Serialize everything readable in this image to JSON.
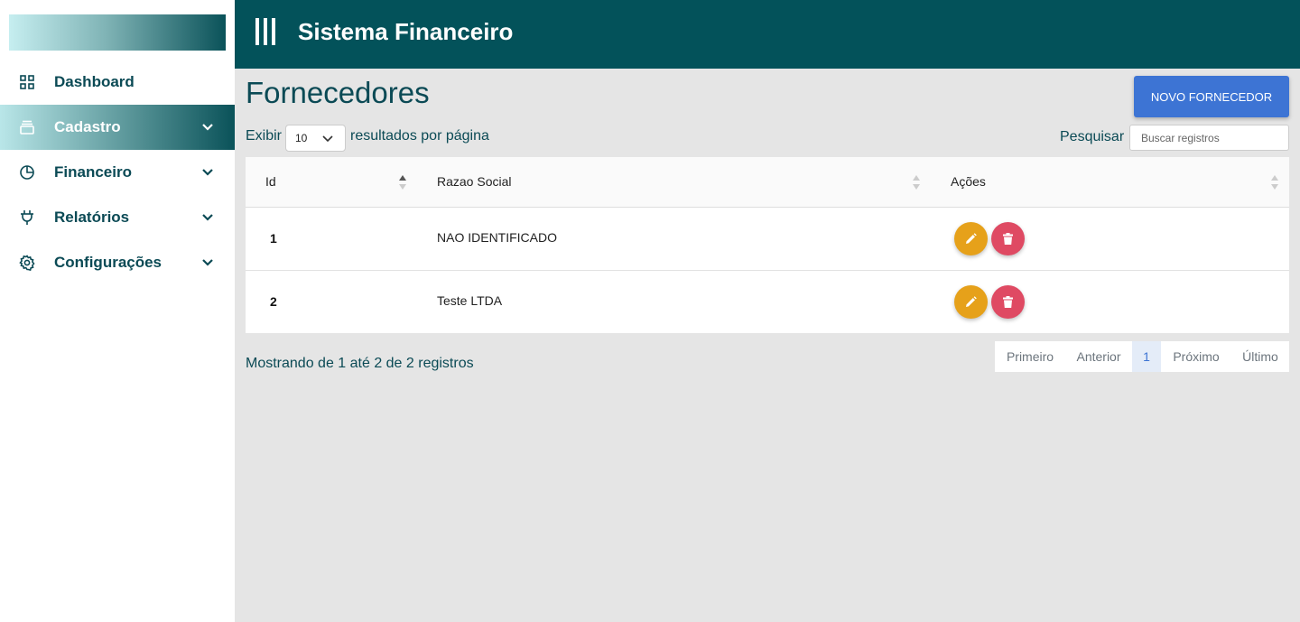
{
  "header": {
    "title": "Sistema Financeiro"
  },
  "sidebar": {
    "items": [
      {
        "label": "Dashboard",
        "icon": "grid-icon",
        "has_submenu": false,
        "active": false
      },
      {
        "label": "Cadastro",
        "icon": "archive-icon",
        "has_submenu": true,
        "active": true
      },
      {
        "label": "Financeiro",
        "icon": "pie-chart-icon",
        "has_submenu": true,
        "active": false
      },
      {
        "label": "Relatórios",
        "icon": "plug-icon",
        "has_submenu": true,
        "active": false
      },
      {
        "label": "Configurações",
        "icon": "gear-icon",
        "has_submenu": true,
        "active": false
      }
    ]
  },
  "page": {
    "title": "Fornecedores",
    "new_button": "NOVO FORNECEDOR",
    "length_prefix": "Exibir",
    "length_value": "10",
    "length_suffix": "resultados por página",
    "search_label": "Pesquisar",
    "search_placeholder": "Buscar registros"
  },
  "table": {
    "columns": [
      "Id",
      "Razao Social",
      "Ações"
    ],
    "rows": [
      {
        "id": "1",
        "razao_social": "NAO IDENTIFICADO"
      },
      {
        "id": "2",
        "razao_social": "Teste LTDA"
      }
    ]
  },
  "footer": {
    "info": "Mostrando de 1 até 2 de 2 registros",
    "pagination": [
      "Primeiro",
      "Anterior",
      "1",
      "Próximo",
      "Último"
    ],
    "current_page": "1"
  },
  "colors": {
    "header_bg": "#03525a",
    "primary_button": "#3d74d4",
    "edit_button": "#e6a11a",
    "delete_button": "#df4a63",
    "text_teal": "#0b4a55"
  }
}
